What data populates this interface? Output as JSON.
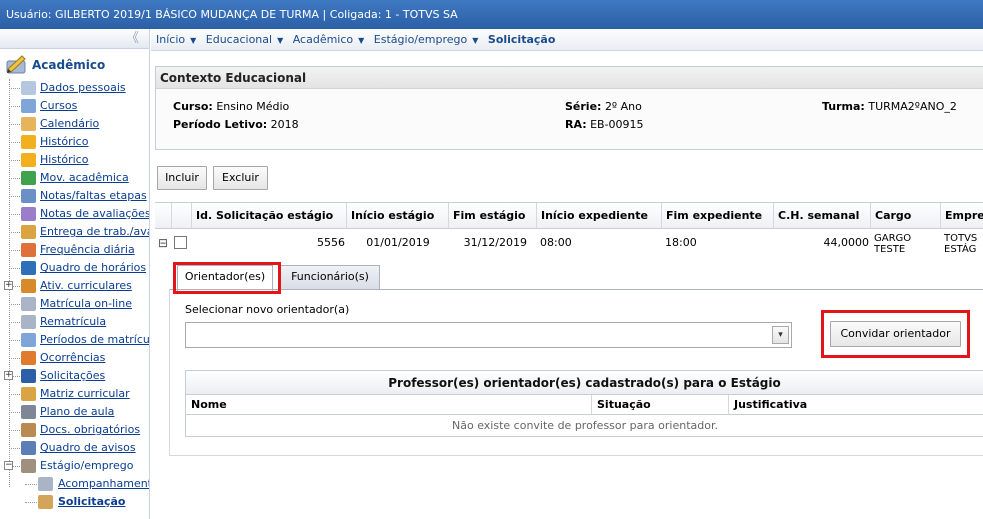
{
  "topbar": {
    "text": "Usuário: GILBERTO 2019/1 BÁSICO MUDANÇA DE TURMA  |  Coligada: 1 - TOTVS SA"
  },
  "sidebar": {
    "collapse_glyph": "《",
    "module_label": "Acadêmico",
    "items": [
      {
        "label": "Dados pessoais",
        "icon": "person-card-icon",
        "color": "#b5c7de"
      },
      {
        "label": "Cursos",
        "icon": "check-book-icon",
        "color": "#7fa6d8"
      },
      {
        "label": "Calendário",
        "icon": "calendar-icon",
        "color": "#e6b45a"
      },
      {
        "label": "Histórico",
        "icon": "pencil-icon",
        "color": "#f2b01e"
      },
      {
        "label": "Histórico",
        "icon": "pencil-icon",
        "color": "#f2b01e"
      },
      {
        "label": "Mov. acadêmica",
        "icon": "green-arrow-icon",
        "color": "#3fa34d"
      },
      {
        "label": "Notas/faltas etapas",
        "icon": "table-icon",
        "color": "#6b8fc7"
      },
      {
        "label": "Notas de avaliações",
        "icon": "pencil-check-icon",
        "color": "#9a7ec9"
      },
      {
        "label": "Entrega de trab./ava",
        "icon": "box-icon",
        "color": "#d9a441"
      },
      {
        "label": "Frequência diária",
        "icon": "attendance-icon",
        "color": "#e0703a"
      },
      {
        "label": "Quadro de horários",
        "icon": "clock-icon",
        "color": "#2f6fb8"
      },
      {
        "label": "Ativ. curriculares",
        "icon": "people-icon",
        "color": "#d88a2a"
      },
      {
        "label": "Matrícula on-line",
        "icon": "globe-icon",
        "color": "#a9b4c6"
      },
      {
        "label": "Rematrícula",
        "icon": "refresh-icon",
        "color": "#a9b4c6"
      },
      {
        "label": "Períodos de matrícula",
        "icon": "calendar-list-icon",
        "color": "#7fa6d8"
      },
      {
        "label": "Ocorrências",
        "icon": "bell-icon",
        "color": "#e07b2e"
      },
      {
        "label": "Solicitações",
        "icon": "request-icon",
        "color": "#2b5fa6"
      },
      {
        "label": "Matriz curricular",
        "icon": "matrix-icon",
        "color": "#d9a441"
      },
      {
        "label": "Plano de aula",
        "icon": "notebook-icon",
        "color": "#7f8796"
      },
      {
        "label": "Docs. obrigatórios",
        "icon": "stamp-icon",
        "color": "#b98a52"
      },
      {
        "label": "Quadro de avisos",
        "icon": "notice-icon",
        "color": "#5b7fb5"
      },
      {
        "label": "Estágio/emprego",
        "icon": "intern-icon",
        "color": "#9e8f7e"
      }
    ],
    "subitems": [
      {
        "label": "Acompanhamento",
        "icon": "tracking-icon",
        "color": "#a9b4c6"
      },
      {
        "label": "Solicitação",
        "icon": "person-icon",
        "color": "#d4a45a"
      }
    ]
  },
  "breadcrumb": {
    "items": [
      "Início",
      "Educacional",
      "Acadêmico",
      "Estágio/emprego"
    ],
    "current": "Solicitação"
  },
  "context": {
    "title": "Contexto Educacional",
    "curso_label": "Curso:",
    "curso_value": "Ensino Médio",
    "periodo_label": "Período Letivo:",
    "periodo_value": "2018",
    "serie_label": "Série:",
    "serie_value": "2º Ano",
    "ra_label": "RA:",
    "ra_value": "EB-00915",
    "turma_label": "Turma:",
    "turma_value": "TURMA2ºANO_2"
  },
  "toolbar": {
    "incluir": "Incluir",
    "excluir": "Excluir"
  },
  "grid": {
    "headers": [
      "Id. Solicitação estágio",
      "Início estágio",
      "Fim estágio",
      "Início expediente",
      "Fim expediente",
      "C.H. semanal",
      "Cargo",
      "Empre"
    ],
    "row": {
      "expander": "⊟",
      "id": "5556",
      "inicio": "01/01/2019",
      "fim": "31/12/2019",
      "inicio_exp": "08:00",
      "fim_exp": "18:00",
      "ch": "44,0000",
      "cargo_line1": "GARGO",
      "cargo_line2": "TESTE",
      "empresa_line1": "TOTVS",
      "empresa_line2": "ESTÁG"
    }
  },
  "tabs": {
    "orientadores": "Orientador(es)",
    "funcionarios": "Funcionário(s)"
  },
  "orientador": {
    "select_label": "Selecionar novo orientador(a)",
    "select_value": "",
    "invite_button": "Convidar orientador",
    "table_title": "Professor(es) orientador(es) cadastrado(s) para o Estágio",
    "col_nome": "Nome",
    "col_situacao": "Situação",
    "col_justificativa": "Justificativa",
    "empty_message": "Não existe convite de professor para orientador."
  },
  "colors": {
    "topbar": "#2f66ae",
    "link": "#0a3d91",
    "highlight": "#e2151b"
  }
}
